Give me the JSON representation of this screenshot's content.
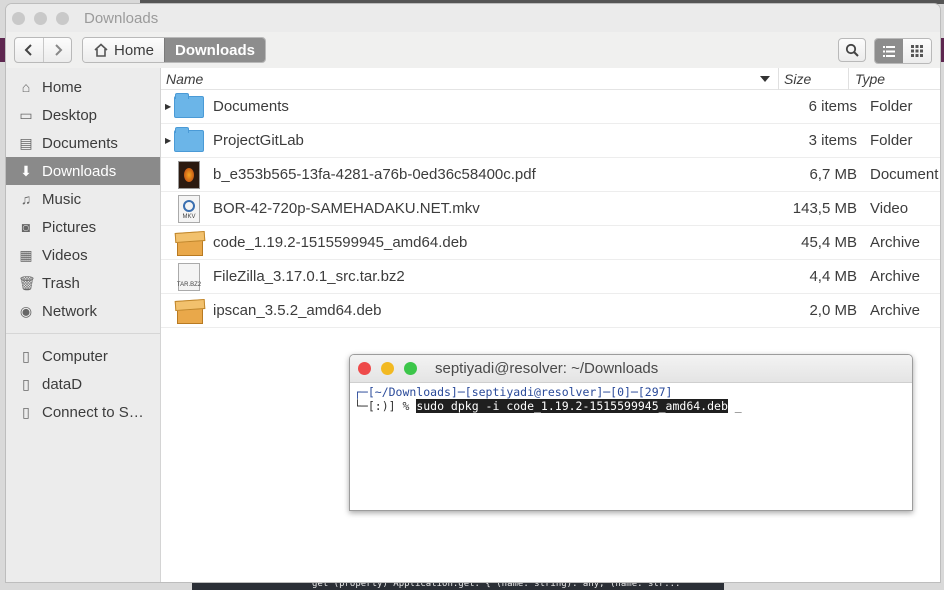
{
  "desktop": {
    "bottom_text": "get (property) Application.get: { (name: string): any, (name: str..."
  },
  "window": {
    "title": "Downloads"
  },
  "toolbar": {
    "back_icon": "chevron-left-icon",
    "forward_icon": "chevron-right-icon",
    "crumbs": [
      {
        "label": "Home",
        "icon": "home-icon"
      },
      {
        "label": "Downloads"
      }
    ]
  },
  "sidebar": {
    "places": [
      {
        "label": "Home",
        "icon": "⌂"
      },
      {
        "label": "Desktop",
        "icon": "▭"
      },
      {
        "label": "Documents",
        "icon": "▤"
      },
      {
        "label": "Downloads",
        "icon": "⬇"
      },
      {
        "label": "Music",
        "icon": "♫"
      },
      {
        "label": "Pictures",
        "icon": "◙"
      },
      {
        "label": "Videos",
        "icon": "▦"
      },
      {
        "label": "Trash",
        "icon": "🗑"
      },
      {
        "label": "Network",
        "icon": "◉"
      }
    ],
    "devices": [
      {
        "label": "Computer",
        "icon": "▯"
      },
      {
        "label": "dataD",
        "icon": "▯"
      },
      {
        "label": "Connect to S…",
        "icon": "▯"
      }
    ]
  },
  "columns": {
    "name": "Name",
    "size": "Size",
    "type": "Type"
  },
  "files": [
    {
      "name": "Documents",
      "size": "6 items",
      "type": "Folder"
    },
    {
      "name": "ProjectGitLab",
      "size": "3 items",
      "type": "Folder"
    },
    {
      "name": "b_e353b565-13fa-4281-a76b-0ed36c58400c.pdf",
      "size": "6,7 MB",
      "type": "Document"
    },
    {
      "name": "BOR-42-720p-SAMEHADAKU.NET.mkv",
      "size": "143,5 MB",
      "type": "Video",
      "icon_label": "MKV"
    },
    {
      "name": "code_1.19.2-1515599945_amd64.deb",
      "size": "45,4 MB",
      "type": "Archive"
    },
    {
      "name": "FileZilla_3.17.0.1_src.tar.bz2",
      "size": "4,4 MB",
      "type": "Archive",
      "icon_label": "TAR.BZ2"
    },
    {
      "name": "ipscan_3.5.2_amd64.deb",
      "size": "2,0 MB",
      "type": "Archive"
    }
  ],
  "terminal": {
    "title": "septiyadi@resolver: ~/Downloads",
    "line1": "┌─[~/Downloads]─[septiyadi@resolver]─[0]─[297]",
    "line2_prefix": "└─[:)] % ",
    "line2_command": "sudo dpkg -i code_1.19.2-1515599945_amd64.deb",
    "cursor": " _"
  }
}
